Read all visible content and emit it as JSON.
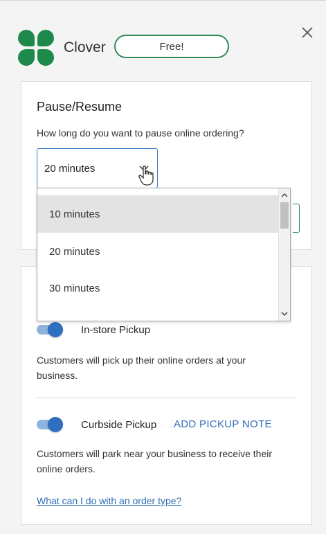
{
  "header": {
    "brand": "Clover",
    "badge": "Free!",
    "close_icon": "close-icon",
    "logo_icon": "clover-logo-icon"
  },
  "pause_card": {
    "title": "Pause/Resume",
    "question": "How long do you want to pause online ordering?",
    "selected": "20 minutes",
    "options": [
      "10 minutes",
      "20 minutes",
      "30 minutes"
    ],
    "hovered_option": "10 minutes"
  },
  "order_types": {
    "in_store": {
      "label": "In-store Pickup",
      "enabled": true,
      "description": "Customers will pick up their online orders at your business."
    },
    "curbside": {
      "label": "Curbside Pickup",
      "enabled": true,
      "action": "ADD PICKUP NOTE",
      "description": "Customers will park near your business to receive their online orders."
    },
    "help_link": "What can I do with an order type?"
  },
  "colors": {
    "brand_green": "#1d8a4c",
    "link_blue": "#2f6db5",
    "toggle_blue": "#2f6fbf"
  }
}
